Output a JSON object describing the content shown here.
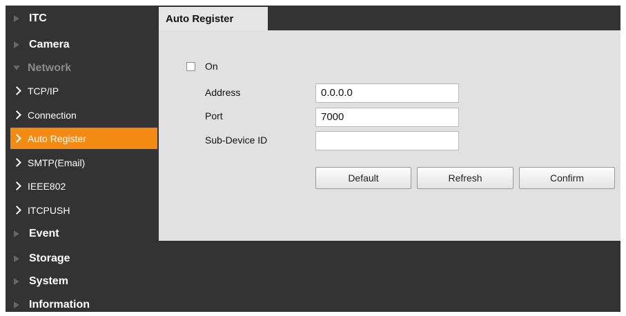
{
  "sidebar": {
    "items": [
      {
        "label": "ITC",
        "level": "top",
        "state": "collapsed"
      },
      {
        "label": "Camera",
        "level": "top",
        "state": "collapsed"
      },
      {
        "label": "Network",
        "level": "top",
        "state": "expanded"
      },
      {
        "label": "TCP/IP",
        "level": "sub"
      },
      {
        "label": "Connection",
        "level": "sub"
      },
      {
        "label": "Auto Register",
        "level": "sub",
        "active": true
      },
      {
        "label": "SMTP(Email)",
        "level": "sub"
      },
      {
        "label": "IEEE802",
        "level": "sub"
      },
      {
        "label": "ITCPUSH",
        "level": "sub"
      },
      {
        "label": "Event",
        "level": "top",
        "state": "collapsed"
      },
      {
        "label": "Storage",
        "level": "top",
        "state": "collapsed"
      },
      {
        "label": "System",
        "level": "top",
        "state": "collapsed"
      },
      {
        "label": "Information",
        "level": "top",
        "state": "collapsed"
      }
    ]
  },
  "tab": {
    "label": "Auto Register"
  },
  "form": {
    "on": {
      "label": "On",
      "checked": false
    },
    "address": {
      "label": "Address",
      "value": "0.0.0.0"
    },
    "port": {
      "label": "Port",
      "value": "7000"
    },
    "sub_device_id": {
      "label": "Sub-Device ID",
      "value": ""
    }
  },
  "buttons": {
    "default": "Default",
    "refresh": "Refresh",
    "confirm": "Confirm"
  },
  "colors": {
    "accent": "#f28a13",
    "sidebar_bg": "#333333",
    "panel_bg": "#e1e1e1"
  }
}
